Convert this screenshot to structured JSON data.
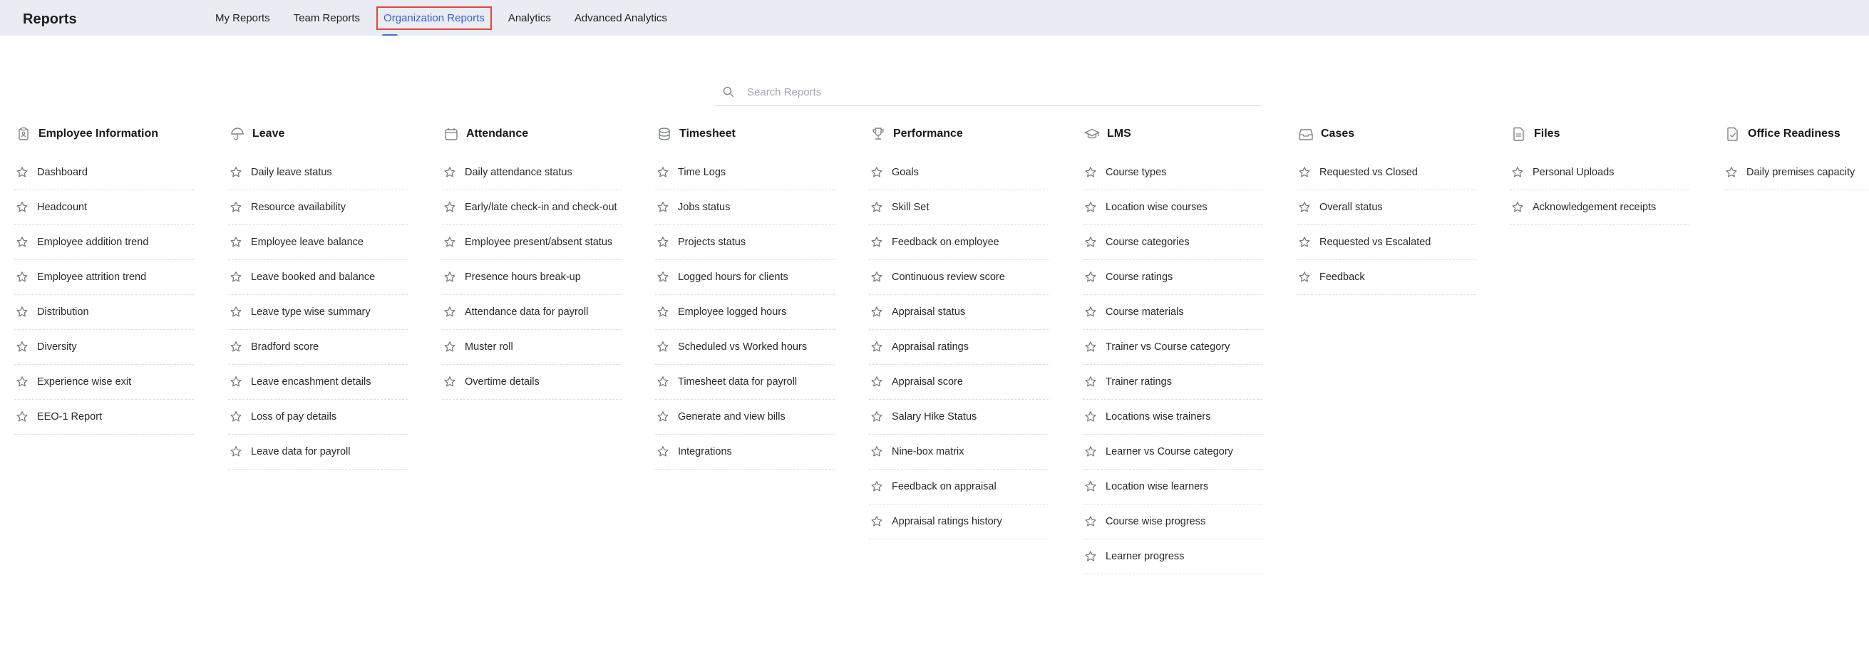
{
  "app": {
    "title": "Reports"
  },
  "tabs": [
    {
      "label": "My Reports"
    },
    {
      "label": "Team Reports"
    },
    {
      "label": "Organization Reports"
    },
    {
      "label": "Analytics"
    },
    {
      "label": "Advanced Analytics"
    }
  ],
  "active_tab": "Organization Reports",
  "search": {
    "placeholder": "Search Reports"
  },
  "categories": [
    {
      "title": "Employee Information",
      "icon": "clipboard-icon",
      "items": [
        "Dashboard",
        "Headcount",
        "Employee addition trend",
        "Employee attrition trend",
        "Distribution",
        "Diversity",
        "Experience wise exit",
        "EEO-1 Report"
      ]
    },
    {
      "title": "Leave",
      "icon": "umbrella-icon",
      "items": [
        "Daily leave status",
        "Resource availability",
        "Employee leave balance",
        "Leave booked and balance",
        "Leave type wise summary",
        "Bradford score",
        "Leave encashment details",
        "Loss of pay details",
        "Leave data for payroll"
      ]
    },
    {
      "title": "Attendance",
      "icon": "calendar-icon",
      "items": [
        "Daily attendance status",
        "Early/late check-in and check-out",
        "Employee present/absent status",
        "Presence hours break-up",
        "Attendance data for payroll",
        "Muster roll",
        "Overtime details"
      ]
    },
    {
      "title": "Timesheet",
      "icon": "database-icon",
      "items": [
        "Time Logs",
        "Jobs status",
        "Projects status",
        "Logged hours for clients",
        "Employee logged hours",
        "Scheduled vs Worked hours",
        "Timesheet data for payroll",
        "Generate and view bills",
        "Integrations"
      ]
    },
    {
      "title": "Performance",
      "icon": "trophy-icon",
      "items": [
        "Goals",
        "Skill Set",
        "Feedback on employee",
        "Continuous review score",
        "Appraisal status",
        "Appraisal ratings",
        "Appraisal score",
        "Salary Hike Status",
        "Nine-box matrix",
        "Feedback on appraisal",
        "Appraisal ratings history"
      ]
    },
    {
      "title": "LMS",
      "icon": "graduation-cap-icon",
      "items": [
        "Course types",
        "Location wise courses",
        "Course categories",
        "Course ratings",
        "Course materials",
        "Trainer vs Course category",
        "Trainer ratings",
        "Locations wise trainers",
        "Learner vs Course category",
        "Location wise learners",
        "Course wise progress",
        "Learner progress"
      ]
    },
    {
      "title": "Cases",
      "icon": "inbox-icon",
      "items": [
        "Requested vs Closed",
        "Overall status",
        "Requested vs Escalated",
        "Feedback"
      ]
    },
    {
      "title": "Files",
      "icon": "file-icon",
      "items": [
        "Personal Uploads",
        "Acknowledgement receipts"
      ]
    },
    {
      "title": "Office Readiness",
      "icon": "document-check-icon",
      "items": [
        "Daily premises capacity"
      ]
    }
  ]
}
